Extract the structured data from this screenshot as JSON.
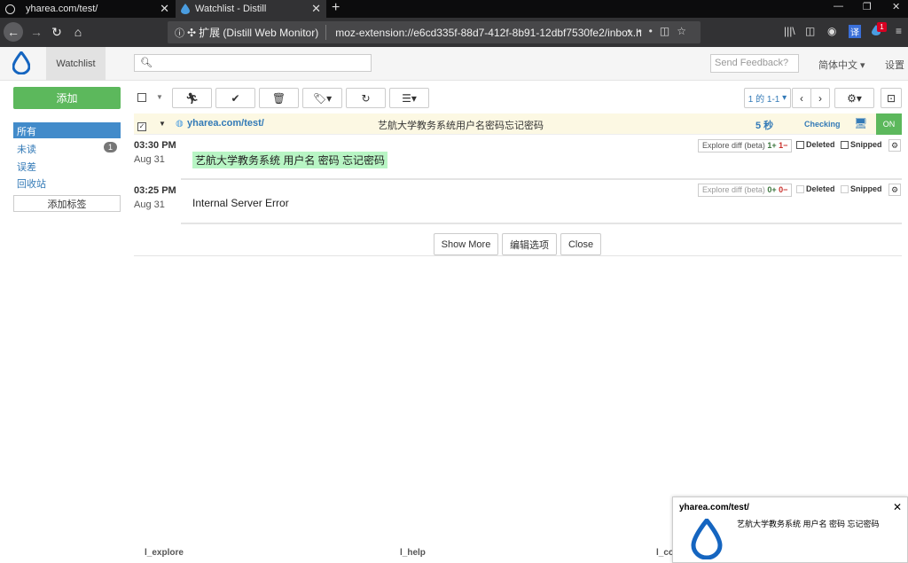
{
  "browser": {
    "tabs": [
      {
        "label": "yharea.com/test/",
        "active": false
      },
      {
        "label": "Watchlist - Distill",
        "active": true
      }
    ],
    "urlbar": {
      "badge": "扩展 (Distill Web Monitor)",
      "url": "moz-extension://e6cd335f-88d7-412f-8b91-12dbf7530fe2/inbox.ht"
    },
    "extension_badge": "1"
  },
  "app": {
    "tab": "Watchlist",
    "search_placeholder": "",
    "feedback_placeholder": "Send Feedback?",
    "language": "简体中文",
    "settings": "设置"
  },
  "sidebar": {
    "add_button": "添加",
    "items": [
      {
        "label": "所有",
        "active": true
      },
      {
        "label": "未读",
        "count": "1"
      },
      {
        "label": "误差"
      },
      {
        "label": "回收站"
      }
    ],
    "add_label": "添加标签"
  },
  "toolbar": {
    "pager": "1 的 1-1"
  },
  "watch": {
    "url": "yharea.com/test/",
    "title": "艺航大学教务系统用户名密码忘记密码",
    "interval": "5 秒",
    "status": "Checking",
    "toggle": "ON"
  },
  "changes": [
    {
      "time": "03:30 PM",
      "date": "Aug 31",
      "text": "艺航大学教务系统 用户名 密码 忘记密码",
      "explore": "Explore diff (beta)",
      "plus": "1+",
      "minus": "1−",
      "deleted": "Deleted",
      "snipped": "Snipped"
    },
    {
      "time": "03:25 PM",
      "date": "Aug 31",
      "text": "Internal Server Error",
      "explore": "Explore diff (beta)",
      "plus": "0+",
      "minus": "0−",
      "deleted": "Deleted",
      "snipped": "Snipped"
    }
  ],
  "actions": {
    "show_more": "Show More",
    "edit_options": "编辑选项",
    "close": "Close"
  },
  "footer": [
    "l_explore",
    "l_help",
    "l_co"
  ],
  "notification": {
    "title": "yharea.com/test/",
    "body": "艺航大学教务系统 用户名 密码 忘记密码"
  },
  "colors": {
    "accent": "#337ab7",
    "green": "#5cb85c",
    "highlight": "#fcf8e3",
    "drop": "#1565c0"
  }
}
